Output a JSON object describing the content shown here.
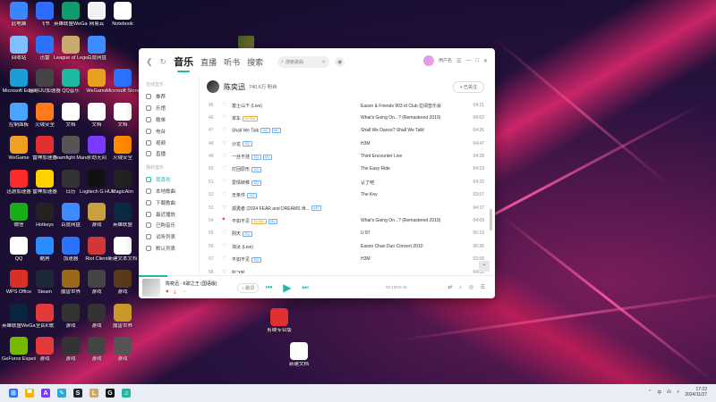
{
  "colors": {
    "accent": "#1fb9a3",
    "liked": "#e63a4a"
  },
  "desktop": {
    "icons": [
      {
        "label": "此电脑",
        "icon": "computer-icon",
        "color": "#3a86ff",
        "col": 0,
        "row": 0
      },
      {
        "label": "飞书",
        "icon": "feishu-icon",
        "color": "#2f6bff",
        "col": 1,
        "row": 0
      },
      {
        "label": "英雄联盟WeGame",
        "icon": "game-icon",
        "color": "#0f9b6a",
        "col": 2,
        "row": 0
      },
      {
        "label": "网易云",
        "icon": "music-icon",
        "color": "#f2f2f2",
        "col": 3,
        "row": 0
      },
      {
        "label": "Notebook",
        "icon": "app-icon",
        "color": "#ffffff",
        "col": 4,
        "row": 0
      },
      {
        "label": "回收站",
        "icon": "recycle-bin-icon",
        "color": "#7fbfff",
        "col": 0,
        "row": 1
      },
      {
        "label": "迅雷",
        "icon": "thunder-icon",
        "color": "#2b73ff",
        "col": 1,
        "row": 1
      },
      {
        "label": "League of Legends",
        "icon": "lol-icon",
        "color": "#c8aa6e",
        "col": 2,
        "row": 1
      },
      {
        "label": "百度网盘",
        "icon": "cloud-icon",
        "color": "#3d8bff",
        "col": 3,
        "row": 1
      },
      {
        "label": "Microsoft Edge",
        "icon": "edge-icon",
        "color": "#1a9ed8",
        "col": 0,
        "row": 2
      },
      {
        "label": "网易UU加速器",
        "icon": "uu-icon",
        "color": "#444",
        "col": 1,
        "row": 2
      },
      {
        "label": "QQ音乐",
        "icon": "qq-music-icon",
        "color": "#1fb9a3",
        "col": 2,
        "row": 2
      },
      {
        "label": "WeGame",
        "icon": "wegame-icon",
        "color": "#e8a020",
        "col": 3,
        "row": 2
      },
      {
        "label": "Microsoft Store",
        "icon": "store-icon",
        "color": "#2b73ff",
        "col": 4,
        "row": 2
      },
      {
        "label": "控制面板",
        "icon": "control-panel-icon",
        "color": "#4aa3ff",
        "col": 0,
        "row": 3
      },
      {
        "label": "火绒安全",
        "icon": "huorong-icon",
        "color": "#ff7a1a",
        "col": 1,
        "row": 3
      },
      {
        "label": "文档",
        "icon": "doc-icon",
        "color": "#ffffff",
        "col": 2,
        "row": 3
      },
      {
        "label": "文档",
        "icon": "doc-icon",
        "color": "#ffffff",
        "col": 3,
        "row": 3
      },
      {
        "label": "文档",
        "icon": "doc-icon",
        "color": "#ffffff",
        "col": 4,
        "row": 3
      },
      {
        "label": "WeGame",
        "icon": "wegame-icon",
        "color": "#f0a020",
        "col": 0,
        "row": 4
      },
      {
        "label": "雷神加速器",
        "icon": "leishen-icon",
        "color": "#e23030",
        "col": 1,
        "row": 4
      },
      {
        "label": "Teamfight Manager",
        "icon": "tm-icon",
        "color": "#555",
        "col": 2,
        "row": 4
      },
      {
        "label": "永劫无间",
        "icon": "game-icon",
        "color": "#7a3aff",
        "col": 3,
        "row": 4
      },
      {
        "label": "火绒安全",
        "icon": "app-icon",
        "color": "#ff8a00",
        "col": 4,
        "row": 4
      },
      {
        "label": "迅游加速器",
        "icon": "app-icon",
        "color": "#ff2a2a",
        "col": 0,
        "row": 5
      },
      {
        "label": "雷神加速器",
        "icon": "app-icon",
        "color": "#ffd200",
        "col": 1,
        "row": 5
      },
      {
        "label": "日历",
        "icon": "calendar-icon",
        "color": "#333",
        "col": 2,
        "row": 5
      },
      {
        "label": "Logitech G HUB",
        "icon": "logitech-icon",
        "color": "#111",
        "col": 3,
        "row": 5
      },
      {
        "label": "MagicAim",
        "icon": "app-icon",
        "color": "#222",
        "col": 4,
        "row": 5
      },
      {
        "label": "微信",
        "icon": "wechat-icon",
        "color": "#1aad19",
        "col": 0,
        "row": 6
      },
      {
        "label": "Hotkeys",
        "icon": "app-icon",
        "color": "#222",
        "col": 1,
        "row": 6
      },
      {
        "label": "百度网盘",
        "icon": "cloud-icon",
        "color": "#3d8bff",
        "col": 2,
        "row": 6
      },
      {
        "label": "游戏",
        "icon": "game-icon",
        "color": "#c8a040",
        "col": 3,
        "row": 6
      },
      {
        "label": "英雄联盟",
        "icon": "lol-icon",
        "color": "#0b2a44",
        "col": 4,
        "row": 6
      },
      {
        "label": "QQ",
        "icon": "qq-icon",
        "color": "#ffffff",
        "col": 0,
        "row": 7
      },
      {
        "label": "酷狗",
        "icon": "kugou-icon",
        "color": "#2b8cff",
        "col": 1,
        "row": 7
      },
      {
        "label": "加速器",
        "icon": "app-icon",
        "color": "#2b73ff",
        "col": 2,
        "row": 7
      },
      {
        "label": "Riot Client",
        "icon": "riot-icon",
        "color": "#d13639",
        "col": 3,
        "row": 7
      },
      {
        "label": "新建文本文档",
        "icon": "text-file-icon",
        "color": "#ffffff",
        "col": 4,
        "row": 7
      },
      {
        "label": "WPS Office",
        "icon": "wps-icon",
        "color": "#d93025",
        "col": 0,
        "row": 8
      },
      {
        "label": "Steam",
        "icon": "steam-icon",
        "color": "#1b2838",
        "col": 1,
        "row": 8
      },
      {
        "label": "魔兽世界",
        "icon": "wow-icon",
        "color": "#9a6a1a",
        "col": 2,
        "row": 8
      },
      {
        "label": "游戏",
        "icon": "game-icon",
        "color": "#444",
        "col": 3,
        "row": 8
      },
      {
        "label": "游戏",
        "icon": "game-icon",
        "color": "#5a3a1a",
        "col": 4,
        "row": 8
      },
      {
        "label": "英雄联盟WeGame",
        "icon": "lol-icon",
        "color": "#0a2540",
        "col": 0,
        "row": 9
      },
      {
        "label": "全民K歌",
        "icon": "app-icon",
        "color": "#e23a3a",
        "col": 1,
        "row": 9
      },
      {
        "label": "游戏",
        "icon": "game-icon",
        "color": "#333",
        "col": 2,
        "row": 9
      },
      {
        "label": "游戏",
        "icon": "game-icon",
        "color": "#333",
        "col": 3,
        "row": 9
      },
      {
        "label": "魔兽世界",
        "icon": "wow-icon",
        "color": "#c89a2a",
        "col": 4,
        "row": 9
      },
      {
        "label": "GeForce Experience",
        "icon": "nvidia-icon",
        "color": "#76b900",
        "col": 0,
        "row": 10
      },
      {
        "label": "游戏",
        "icon": "game-icon",
        "color": "#e23a3a",
        "col": 1,
        "row": 10
      },
      {
        "label": "游戏",
        "icon": "game-icon",
        "color": "#333",
        "col": 2,
        "row": 10
      },
      {
        "label": "游戏",
        "icon": "game-icon",
        "color": "#444",
        "col": 3,
        "row": 10
      },
      {
        "label": "游戏",
        "icon": "game-icon",
        "color": "#555",
        "col": 4,
        "row": 10
      },
      {
        "label": "剪映专业版",
        "icon": "capcut-icon",
        "color": "#e23030",
        "col": 7,
        "row": 8
      },
      {
        "label": "新建文档",
        "icon": "doc-icon",
        "color": "#ffffff",
        "col": 8,
        "row": 10
      }
    ]
  },
  "app": {
    "tabs": [
      {
        "label": "音乐",
        "active": true
      },
      {
        "label": "直播",
        "active": false
      },
      {
        "label": "听书",
        "active": false
      },
      {
        "label": "搜索",
        "active": false
      }
    ],
    "search_placeholder": "搜索歌曲",
    "user_name": "用户名",
    "window_buttons": [
      "☰",
      "—",
      "□",
      "✕"
    ],
    "sidebar": {
      "section1": "在线音乐",
      "section2": "我的音乐",
      "online_items": [
        "推荐",
        "乐馆",
        "歌单",
        "电台",
        "视频",
        "直播"
      ],
      "my_items": [
        {
          "label": "我喜欢",
          "active": true
        },
        {
          "label": "本地歌曲",
          "active": false
        },
        {
          "label": "下载歌曲",
          "active": false
        },
        {
          "label": "最近播放",
          "active": false
        },
        {
          "label": "已购音乐",
          "active": false
        },
        {
          "label": "试听列表",
          "active": false
        },
        {
          "label": "默认列表",
          "active": false
        }
      ]
    },
    "artist": {
      "name": "陈奕迅",
      "fans": "740.6万 粉丝",
      "follow": "+ 已关注"
    },
    "songs": [
      {
        "num": "45",
        "title": "富士山下 (Live)",
        "liked": false,
        "badges": [],
        "album": "Eason & Friends 903 id Club 拉阔音乐会",
        "duration": "04:21"
      },
      {
        "num": "46",
        "title": "单车",
        "liked": false,
        "badges": [
          "Hi-Res"
        ],
        "album": "What's Going On...? (Remastered 2019)",
        "duration": "04:52"
      },
      {
        "num": "47",
        "title": "Shall We Talk",
        "liked": false,
        "badges": [
          "SQ",
          "MV"
        ],
        "album": "Shall We Dance? Shall We Talk!",
        "duration": "04:26"
      },
      {
        "num": "48",
        "title": "沙龙",
        "liked": false,
        "badges": [
          "SQ"
        ],
        "album": "H3M",
        "duration": "04:47"
      },
      {
        "num": "49",
        "title": "一丝不挂",
        "liked": false,
        "badges": [
          "SQ",
          "MV"
        ],
        "album": "Third Encounter Live",
        "duration": "04:28"
      },
      {
        "num": "50",
        "title": "打回原形",
        "liked": false,
        "badges": [
          "SQ"
        ],
        "album": "The Easy Ride",
        "duration": "04:10"
      },
      {
        "num": "51",
        "title": "爱情转移",
        "liked": false,
        "badges": [
          "SQ"
        ],
        "album": "认了吧",
        "duration": "04:20"
      },
      {
        "num": "52",
        "title": "无条件",
        "liked": false,
        "badges": [
          "SQ"
        ],
        "album": "The Key",
        "duration": "03:57"
      },
      {
        "num": "53",
        "title": "孤勇者 (2024 FEAR and DREAMS 世...",
        "liked": false,
        "badges": [
          "MV"
        ],
        "album": "",
        "duration": "04:37"
      },
      {
        "num": "54",
        "title": "不如不见",
        "liked": true,
        "badges": [
          "Hi-Res",
          "MV"
        ],
        "album": "What's Going On...? (Remastered 2019)",
        "duration": "04:09"
      },
      {
        "num": "55",
        "title": "阴天",
        "liked": false,
        "badges": [
          "SQ"
        ],
        "album": "U 87",
        "duration": "05:16"
      },
      {
        "num": "56",
        "title": "淘汰 (Live)",
        "liked": false,
        "badges": [],
        "album": "Eason Chan Duo Concert 2010",
        "duration": "05:36"
      },
      {
        "num": "57",
        "title": "不如不见",
        "liked": false,
        "badges": [
          "SQ"
        ],
        "album": "H3M",
        "duration": "03:58"
      },
      {
        "num": "58",
        "title": "陀飞轮",
        "liked": false,
        "badges": [],
        "album": "",
        "duration": "04:03"
      }
    ],
    "player": {
      "now_playing": "陈奕迅 - K歌之王 (国语版)",
      "lyric_tag": "♪ 歌词",
      "time": "00:19/03:45",
      "progress": 0.08
    }
  },
  "taskbar": {
    "icons": [
      {
        "name": "start-icon",
        "glyph": "⊞",
        "color": "#2b73ff"
      },
      {
        "name": "file-explorer-icon",
        "glyph": "▀",
        "color": "#f4b400"
      },
      {
        "name": "app-icon",
        "glyph": "A",
        "color": "#7a3aff"
      },
      {
        "name": "app-icon",
        "glyph": "✎",
        "color": "#2aa7d8"
      },
      {
        "name": "steam-icon",
        "glyph": "S",
        "color": "#1b2838"
      },
      {
        "name": "lol-icon",
        "glyph": "L",
        "color": "#c8aa6e"
      },
      {
        "name": "app-icon",
        "glyph": "G",
        "color": "#111"
      },
      {
        "name": "qq-music-icon",
        "glyph": "♫",
        "color": "#1fb9a3"
      }
    ],
    "time": "17:22",
    "date": "2024/11/27",
    "tray": [
      "⌃",
      "中",
      "☊",
      "⚡"
    ]
  }
}
